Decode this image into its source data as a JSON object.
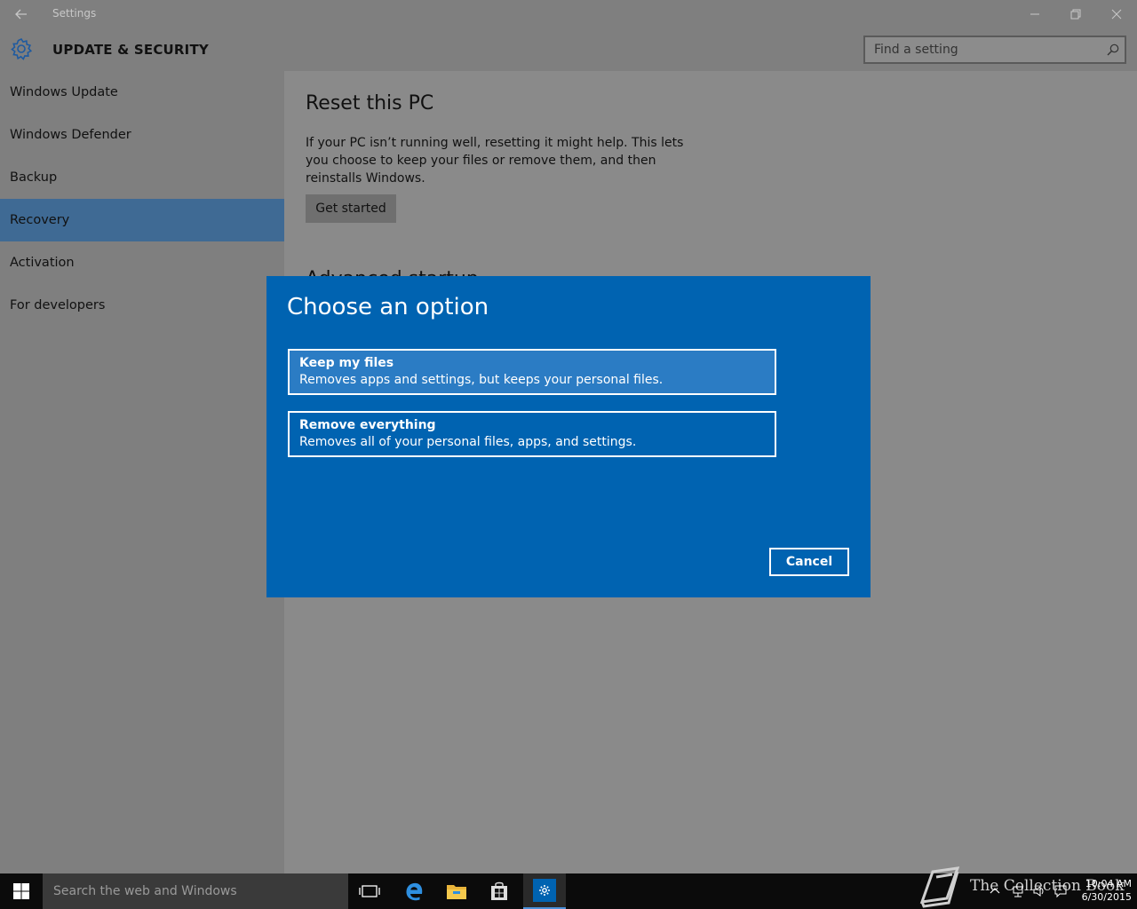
{
  "window": {
    "title": "Settings",
    "section_title": "UPDATE & SECURITY",
    "search_placeholder": "Find a setting"
  },
  "sidebar": {
    "items": [
      {
        "label": "Windows Update"
      },
      {
        "label": "Windows Defender"
      },
      {
        "label": "Backup"
      },
      {
        "label": "Recovery",
        "selected": true
      },
      {
        "label": "Activation"
      },
      {
        "label": "For developers"
      }
    ]
  },
  "content": {
    "heading": "Reset this PC",
    "description": "If your PC isn’t running well, resetting it might help. This lets you choose to keep your files or remove them, and then reinstalls Windows.",
    "get_started_label": "Get started",
    "next_heading": "Advanced startup"
  },
  "dialog": {
    "title": "Choose an option",
    "options": [
      {
        "title": "Keep my files",
        "description": "Removes apps and settings, but keeps your personal files."
      },
      {
        "title": "Remove everything",
        "description": "Removes all of your personal files, apps, and settings."
      }
    ],
    "cancel_label": "Cancel",
    "accent_color": "#0063b1"
  },
  "taskbar": {
    "search_placeholder": "Search the web and Windows",
    "apps": [
      "task-view-icon",
      "edge-icon",
      "file-explorer-icon",
      "store-icon",
      "settings-icon"
    ],
    "watermark": "The Collection Book",
    "time": "10:04 AM",
    "date": "6/30/2015"
  }
}
